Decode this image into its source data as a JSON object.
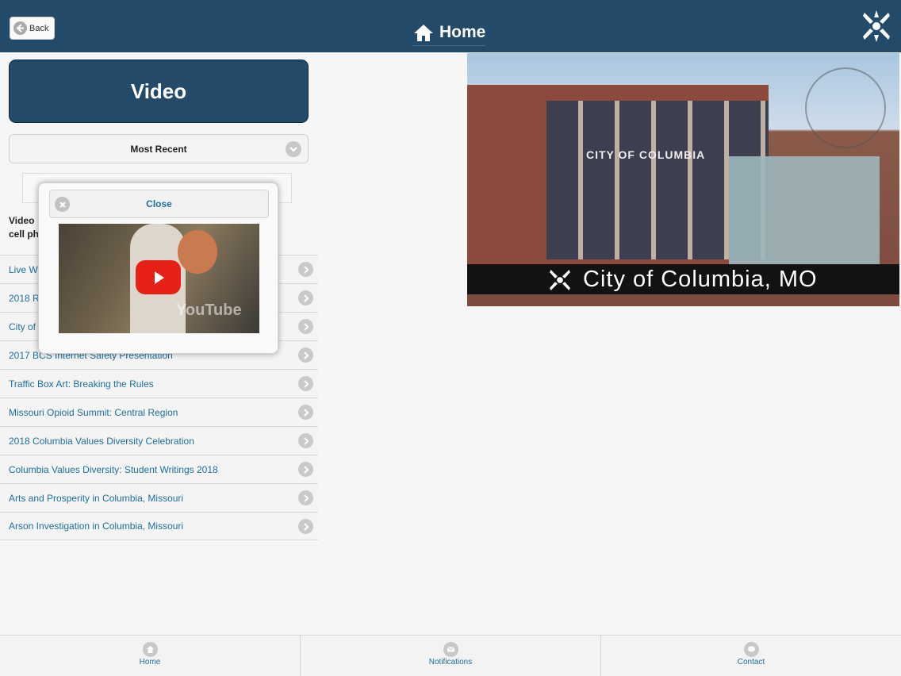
{
  "header": {
    "back_label": "Back",
    "title": "Home"
  },
  "video_section": {
    "title": "Video",
    "sort_select": "Most Recent",
    "description_line1": "Video",
    "description_line2": "cell ph"
  },
  "popup": {
    "close_label": "Close",
    "video_watermark": "YouTube"
  },
  "video_list": [
    {
      "title": "Live W"
    },
    {
      "title": "2018 R"
    },
    {
      "title": "City of"
    },
    {
      "title": "2017 BCS Internet Safety Presentation"
    },
    {
      "title": "Traffic Box Art: Breaking the Rules"
    },
    {
      "title": "Missouri Opioid Summit: Central Region"
    },
    {
      "title": "2018 Columbia Values Diversity Celebration"
    },
    {
      "title": "Columbia Values Diversity: Student Writings 2018"
    },
    {
      "title": "Arts and Prosperity in Columbia, Missouri"
    },
    {
      "title": "Arson Investigation in Columbia, Missouri"
    }
  ],
  "banner": {
    "caption": "City of Columbia, MO",
    "building_sign": "CITY OF COLUMBIA"
  },
  "footer": {
    "tabs": [
      {
        "label": "Home",
        "icon": "home-icon"
      },
      {
        "label": "Notifications",
        "icon": "mail-icon"
      },
      {
        "label": "Contact",
        "icon": "chat-icon"
      }
    ]
  },
  "colors": {
    "header_bg": "#234b69",
    "link": "#1f6f9c",
    "youtube_red": "#e62117"
  }
}
